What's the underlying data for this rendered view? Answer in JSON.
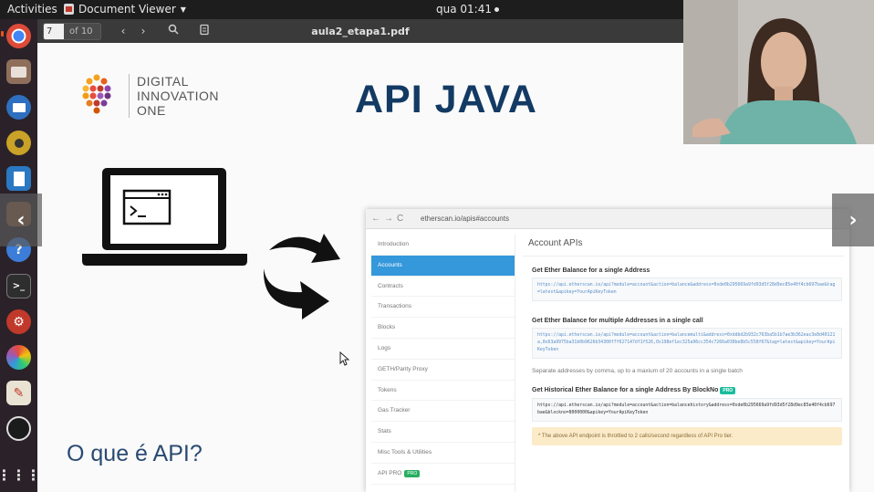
{
  "topbar": {
    "activities": "Activities",
    "app_name": "Document Viewer",
    "clock": "qua 01:41"
  },
  "dock": {
    "items": [
      {
        "icon": "chrome-icon",
        "color": "#dd4b39"
      },
      {
        "icon": "files-icon",
        "color": "#8f6f5c"
      },
      {
        "icon": "thunderbird-icon",
        "color": "#2f6fbf"
      },
      {
        "icon": "rhythmbox-icon",
        "color": "#c9a227"
      },
      {
        "icon": "writer-icon",
        "color": "#2a78c2"
      },
      {
        "icon": "folder-icon",
        "color": "#8b5a3c"
      },
      {
        "icon": "help-icon",
        "color": "#3b7dd8"
      },
      {
        "icon": "terminal-icon",
        "color": "#2e2e2e"
      },
      {
        "icon": "settings-icon",
        "color": "#c0392b"
      },
      {
        "icon": "gradient-app-icon",
        "color": "#9b59b6"
      },
      {
        "icon": "text-editor-icon",
        "color": "#e8e3d3"
      },
      {
        "icon": "obs-icon",
        "color": "#1b1b1b"
      },
      {
        "icon": "show-apps-icon",
        "color": "#2b2229"
      }
    ]
  },
  "viewer": {
    "page_current": "7",
    "page_total": "of 10",
    "filename": "aula2_etapa1.pdf"
  },
  "slide": {
    "logo_line1": "DIGITAL",
    "logo_line2": "INNOVATION",
    "logo_line3": "ONE",
    "title": "API JAVA",
    "question": "O que é API?"
  },
  "browser": {
    "url": "etherscan.io/apis#accounts",
    "sidebar": [
      "Introduction",
      "Accounts",
      "Contracts",
      "Transactions",
      "Blocks",
      "Logs",
      "GETH/Parity Proxy",
      "Tokens",
      "Gas Tracker",
      "Stats",
      "Misc Tools & Utilities",
      "API PRO"
    ],
    "sidebar_active_index": 1,
    "pro_badge": "PRO",
    "heading": "Account APIs",
    "sec1_title": "Get Ether Balance for a single Address",
    "sec1_code": "https://api.etherscan.io/api?module=account&action=balance&address=0xde0b295669a9fd93d5f28d9ec85e40f4cb697bae&tag=latest&apikey=YourApiKeyToken",
    "sec2_title": "Get Ether Balance for multiple Addresses in a single call",
    "sec2_code": "https://api.etherscan.io/api?module=account&action=balancemulti&address=0xddbd2b932c763ba5b1b7ae3b362eac3e8d40121a,0x63a9975ba31b0b9626b34300f7f627147df1f526,0x198ef1ec325a96cc354c7266a038be8b5c558f67&tag=latest&apikey=YourApiKeyToken",
    "sec2_note": "Separate addresses by comma, up to a maxium of 20 accounts in a single batch",
    "sec3_title": "Get Historical Ether Balance for a single Address By BlockNo",
    "sec3_code": "https://api.etherscan.io/api?module=account&action=balancehistory&address=0xde0b295669a9fd93d5f28d9ec85e40f4cb697bae&blockno=8000000&apikey=YourApiKeyToken",
    "sec3_warn": "* The above API endpoint is throttled to 2 calls/second regardless of API Pro tier."
  }
}
